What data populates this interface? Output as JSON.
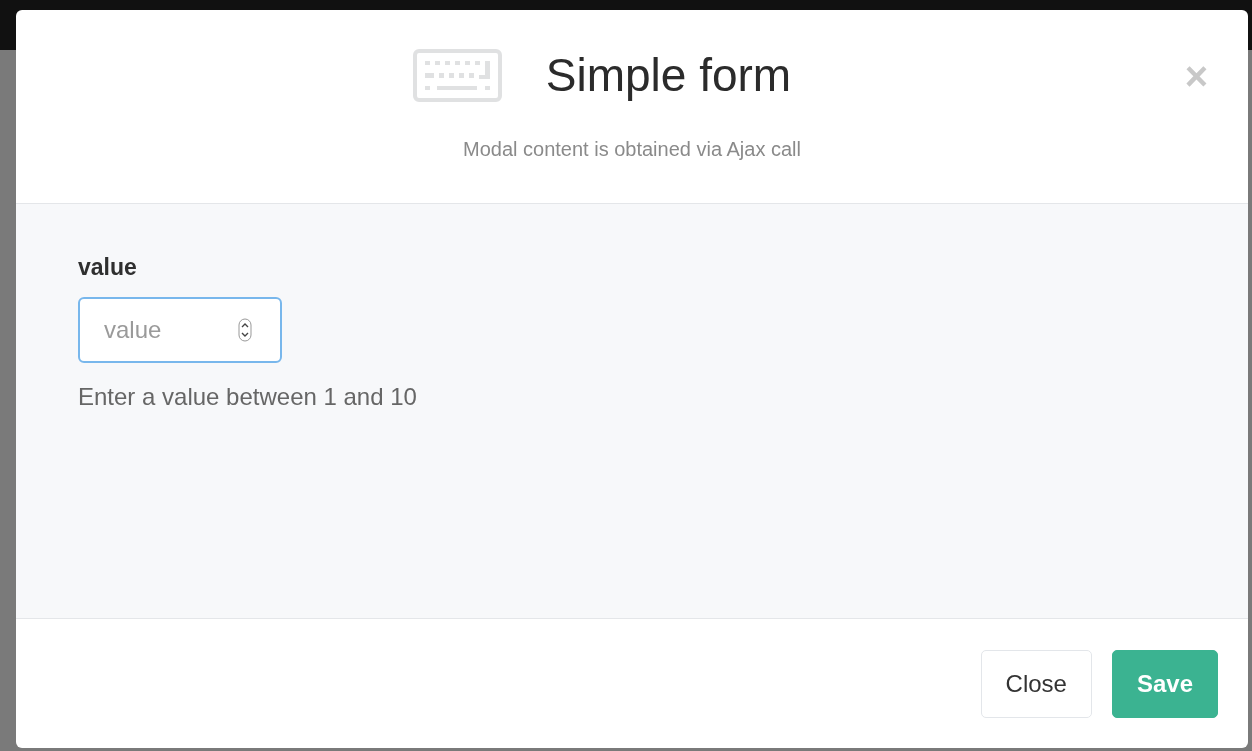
{
  "modal": {
    "title": "Simple form",
    "close_symbol": "×",
    "subtitle": "Modal content is obtained via Ajax call"
  },
  "form": {
    "label": "value",
    "field": {
      "placeholder": "value",
      "focused": true
    },
    "help": "Enter a value between 1 and 10"
  },
  "buttons": [
    {
      "label": "Close",
      "kind": "default"
    },
    {
      "label": "Save",
      "kind": "primary"
    }
  ]
}
